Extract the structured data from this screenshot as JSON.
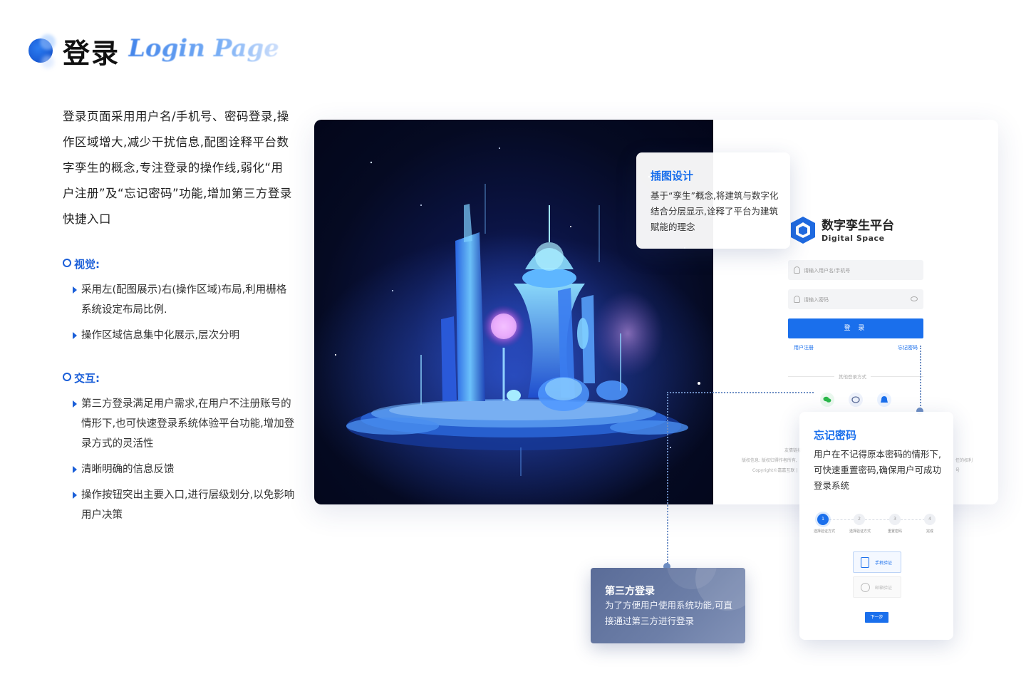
{
  "header": {
    "title_cn": "登录",
    "title_en": "Login Page"
  },
  "intro": "登录页面采用用户名/手机号、密码登录,操作区域增大,减少干扰信息,配图诠释平台数字孪生的概念,专注登录的操作线,弱化“用户注册”及“忘记密码”功能,增加第三方登录快捷入口",
  "visual": {
    "title": "视觉:",
    "items": [
      "采用左(配图展示)右(操作区域)布局,利用栅格系统设定布局比例.",
      "操作区域信息集中化展示,层次分明"
    ]
  },
  "interaction": {
    "title": "交互:",
    "items": [
      "第三方登录满足用户需求,在用户不注册账号的情形下,也可快速登录系统体验平台功能,增加登录方式的灵活性",
      "清晰明确的信息反馈",
      "操作按钮突出主要入口,进行层级划分,以免影响用户决策"
    ]
  },
  "login": {
    "brand_cn": "数字孪生平台",
    "brand_en": "Digital Space",
    "username_placeholder": "请输入用户名/手机号",
    "password_placeholder": "请输入密码",
    "login_button": "登 录",
    "register_link": "用户注册",
    "forgot_link": "忘记密码",
    "other_methods": "其他登录方式",
    "footer_line1": "友情链接",
    "footer_line2": "版权信息: 版权归得作者所有,",
    "footer_line2b": "任的权利",
    "footer_line3": "Copyright©嘉嘉互联 |",
    "footer_line3b": "号"
  },
  "callout_illus": {
    "title": "插图设计",
    "text": "基于“孪生”概念,将建筑与数字化结合分层显示,诠释了平台为建筑赋能的理念"
  },
  "callout_forgot": {
    "title": "忘记密码",
    "text": "用户在不记得原本密码的情形下,可快速重置密码,确保用户可成功登录系统",
    "steps": [
      {
        "num": "1",
        "label": "选择验证方式"
      },
      {
        "num": "2",
        "label": "选择验证方式"
      },
      {
        "num": "3",
        "label": "重置密码"
      },
      {
        "num": "4",
        "label": "完成"
      }
    ],
    "option_phone": "手机验证",
    "option_email": "邮箱验证",
    "next_button": "下一步"
  },
  "callout_third": {
    "title": "第三方登录",
    "text": "为了方便用户使用系统功能,可直接通过第三方进行登录"
  },
  "colors": {
    "accent": "#1a6fec",
    "third_bg": "#6d7fa8"
  }
}
